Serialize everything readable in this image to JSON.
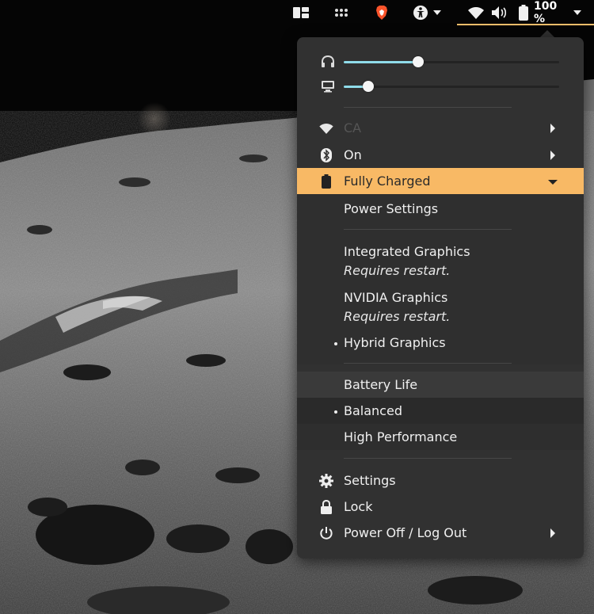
{
  "topbar": {
    "workspaces_icon": "workspaces-icon",
    "apps_icon": "app-grid-icon",
    "browser_icon": "brave-browser-icon",
    "accessibility_icon": "accessibility-icon",
    "wifi_icon": "wifi-icon",
    "volume_icon": "volume-icon",
    "battery_icon": "battery-icon",
    "battery_percent": "100 %",
    "accent_color": "#f5bd6a"
  },
  "panel": {
    "sliders": [
      {
        "icon": "headphones-icon",
        "value": 0.37
      },
      {
        "icon": "display-icon",
        "value": 0.12
      }
    ],
    "wifi": {
      "icon": "wifi-icon",
      "label": "CA"
    },
    "bluetooth": {
      "icon": "bluetooth-icon",
      "label": "On"
    },
    "power": {
      "icon": "battery-icon",
      "label": "Fully Charged",
      "highlight_color": "#f8b965",
      "power_settings": "Power Settings",
      "graphics": [
        {
          "label": "Integrated Graphics",
          "note": "Requires restart.",
          "selected": false
        },
        {
          "label": "NVIDIA Graphics",
          "note": "Requires restart.",
          "selected": false
        },
        {
          "label": "Hybrid Graphics",
          "note": "",
          "selected": true
        }
      ],
      "profiles": [
        {
          "label": "Battery Life",
          "selected": false
        },
        {
          "label": "Balanced",
          "selected": true
        },
        {
          "label": "High Performance",
          "selected": false
        }
      ]
    },
    "actions": {
      "settings": {
        "icon": "gear-icon",
        "label": "Settings"
      },
      "lock": {
        "icon": "lock-icon",
        "label": "Lock"
      },
      "power_off": {
        "icon": "power-icon",
        "label": "Power Off / Log Out"
      }
    }
  }
}
